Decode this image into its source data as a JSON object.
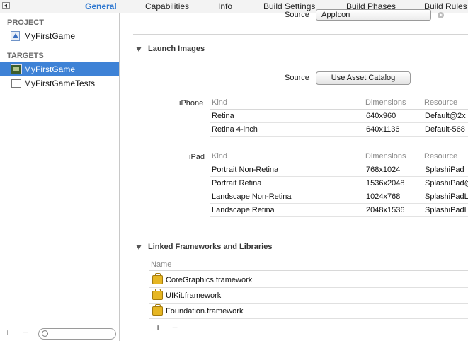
{
  "tabs": [
    "General",
    "Capabilities",
    "Info",
    "Build Settings",
    "Build Phases",
    "Build Rules"
  ],
  "active_tab": "General",
  "sidebar": {
    "project_header": "PROJECT",
    "project_item": "MyFirstGame",
    "targets_header": "TARGETS",
    "targets": [
      "MyFirstGame",
      "MyFirstGameTests"
    ],
    "add_label": "+",
    "remove_label": "−"
  },
  "app_icons": {
    "source_label": "Source",
    "source_value": "AppIcon"
  },
  "launch_images": {
    "title": "Launch Images",
    "source_label": "Source",
    "button_label": "Use Asset Catalog",
    "iphone": {
      "label": "iPhone",
      "headers": [
        "Kind",
        "Dimensions",
        "Resource"
      ],
      "rows": [
        [
          "Retina",
          "640x960",
          "Default@2x"
        ],
        [
          "Retina 4-inch",
          "640x1136",
          "Default-568"
        ]
      ]
    },
    "ipad": {
      "label": "iPad",
      "headers": [
        "Kind",
        "Dimensions",
        "Resource"
      ],
      "rows": [
        [
          "Portrait Non-Retina",
          "768x1024",
          "SplashiPad"
        ],
        [
          "Portrait Retina",
          "1536x2048",
          "SplashiPad@"
        ],
        [
          "Landscape Non-Retina",
          "1024x768",
          "SplashiPadL"
        ],
        [
          "Landscape Retina",
          "2048x1536",
          "SplashiPadL"
        ]
      ]
    }
  },
  "linked_frameworks": {
    "title": "Linked Frameworks and Libraries",
    "column_header": "Name",
    "items": [
      "CoreGraphics.framework",
      "UIKit.framework",
      "Foundation.framework"
    ],
    "add_label": "+",
    "remove_label": "−"
  }
}
